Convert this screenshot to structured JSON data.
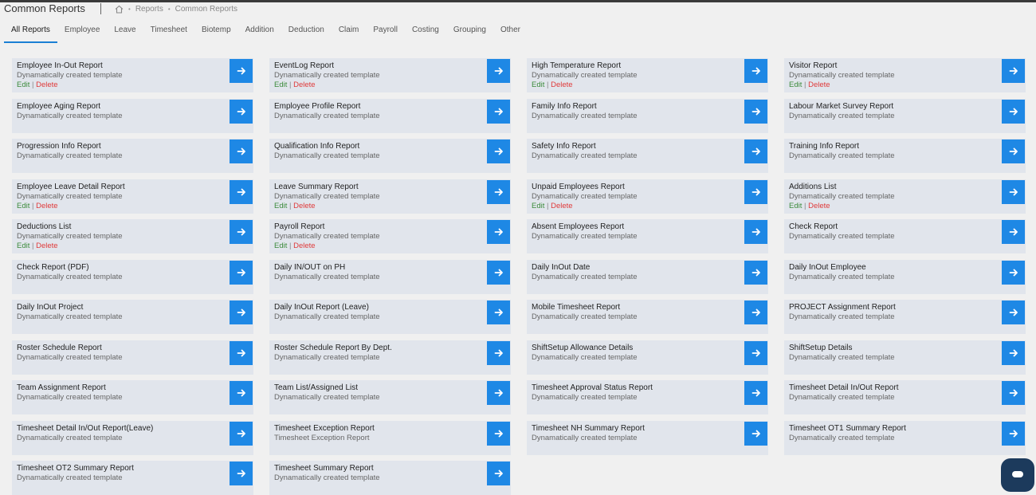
{
  "header": {
    "title": "Common Reports",
    "breadcrumb": [
      "Reports",
      "Common Reports"
    ]
  },
  "tabs": [
    "All Reports",
    "Employee",
    "Leave",
    "Timesheet",
    "Biotemp",
    "Addition",
    "Deduction",
    "Claim",
    "Payroll",
    "Costing",
    "Grouping",
    "Other"
  ],
  "active_tab": "All Reports",
  "action_labels": {
    "edit": "Edit",
    "separator": "|",
    "delete": "Delete"
  },
  "reports": [
    {
      "title": "Employee In-Out Report",
      "desc": "Dynamatically created template",
      "editable": true
    },
    {
      "title": "EventLog Report",
      "desc": "Dynamatically created template",
      "editable": true
    },
    {
      "title": "High Temperature Report",
      "desc": "Dynamatically created template",
      "editable": true
    },
    {
      "title": "Visitor Report",
      "desc": "Dynamatically created template",
      "editable": true
    },
    {
      "title": "Employee Aging Report",
      "desc": "Dynamatically created template",
      "editable": false
    },
    {
      "title": "Employee Profile Report",
      "desc": "Dynamatically created template",
      "editable": false
    },
    {
      "title": "Family Info Report",
      "desc": "Dynamatically created template",
      "editable": false
    },
    {
      "title": "Labour Market Survey Report",
      "desc": "Dynamatically created template",
      "editable": false
    },
    {
      "title": "Progression Info Report",
      "desc": "Dynamatically created template",
      "editable": false
    },
    {
      "title": "Qualification Info Report",
      "desc": "Dynamatically created template",
      "editable": false
    },
    {
      "title": "Safety Info Report",
      "desc": "Dynamatically created template",
      "editable": false
    },
    {
      "title": "Training Info Report",
      "desc": "Dynamatically created template",
      "editable": false
    },
    {
      "title": "Employee Leave Detail Report",
      "desc": "Dynamatically created template",
      "editable": true
    },
    {
      "title": "Leave Summary Report",
      "desc": "Dynamatically created template",
      "editable": true
    },
    {
      "title": "Unpaid Employees Report",
      "desc": "Dynamatically created template",
      "editable": true
    },
    {
      "title": "Additions List",
      "desc": "Dynamatically created template",
      "editable": true
    },
    {
      "title": "Deductions List",
      "desc": "Dynamatically created template",
      "editable": true
    },
    {
      "title": "Payroll Report",
      "desc": "Dynamatically created template",
      "editable": true
    },
    {
      "title": "Absent Employees Report",
      "desc": "Dynamatically created template",
      "editable": false
    },
    {
      "title": "Check Report",
      "desc": "Dynamatically created template",
      "editable": false
    },
    {
      "title": "Check Report (PDF)",
      "desc": "Dynamatically created template",
      "editable": false
    },
    {
      "title": "Daily IN/OUT on PH",
      "desc": "Dynamatically created template",
      "editable": false
    },
    {
      "title": "Daily InOut Date",
      "desc": "Dynamatically created template",
      "editable": false
    },
    {
      "title": "Daily InOut Employee",
      "desc": "Dynamatically created template",
      "editable": false
    },
    {
      "title": "Daily InOut Project",
      "desc": "Dynamatically created template",
      "editable": false
    },
    {
      "title": "Daily InOut Report (Leave)",
      "desc": "Dynamatically created template",
      "editable": false
    },
    {
      "title": "Mobile Timesheet Report",
      "desc": "Dynamatically created template",
      "editable": false
    },
    {
      "title": "PROJECT Assignment Report",
      "desc": "Dynamatically created template",
      "editable": false
    },
    {
      "title": "Roster Schedule Report",
      "desc": "Dynamatically created template",
      "editable": false
    },
    {
      "title": "Roster Schedule Report By Dept.",
      "desc": "Dynamatically created template",
      "editable": false
    },
    {
      "title": "ShiftSetup Allowance Details",
      "desc": "Dynamatically created template",
      "editable": false
    },
    {
      "title": "ShiftSetup Details",
      "desc": "Dynamatically created template",
      "editable": false
    },
    {
      "title": "Team Assignment Report",
      "desc": "Dynamatically created template",
      "editable": false
    },
    {
      "title": "Team List/Assigned List",
      "desc": "Dynamatically created template",
      "editable": false
    },
    {
      "title": "Timesheet Approval Status Report",
      "desc": "Dynamatically created template",
      "editable": false
    },
    {
      "title": "Timesheet Detail In/Out Report",
      "desc": "Dynamatically created template",
      "editable": false
    },
    {
      "title": "Timesheet Detail In/Out Report(Leave)",
      "desc": "Dynamatically created template",
      "editable": false
    },
    {
      "title": "Timesheet Exception Report",
      "desc": "Timesheet Exception Report",
      "editable": false
    },
    {
      "title": "Timesheet NH Summary Report",
      "desc": "Dynamatically created template",
      "editable": false
    },
    {
      "title": "Timesheet OT1 Summary Report",
      "desc": "Dynamatically created template",
      "editable": false
    },
    {
      "title": "Timesheet OT2 Summary Report",
      "desc": "Dynamatically created template",
      "editable": false
    },
    {
      "title": "Timesheet Summary Report",
      "desc": "Dynamatically created template",
      "editable": false
    }
  ]
}
